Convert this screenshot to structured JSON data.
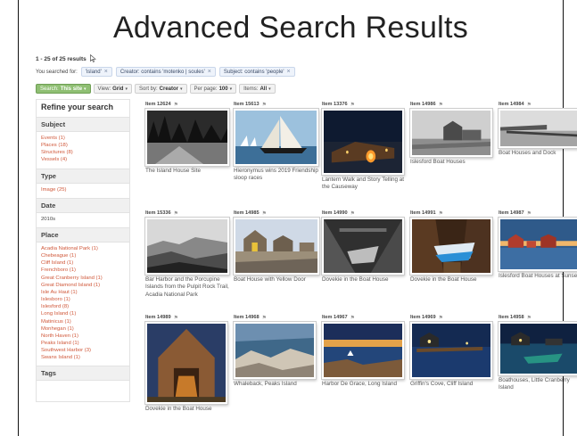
{
  "page_title": "Advanced Search Results",
  "results_count": "1 - 25 of 25 results",
  "searched_for_label": "You searched for:",
  "search_chips": [
    {
      "text": "'island'",
      "close": "×"
    },
    {
      "text": "Creator: contains 'motenko | soules'",
      "close": "×"
    },
    {
      "text": "Subject: contains 'people'",
      "close": "×"
    }
  ],
  "toolbar": {
    "search_prefix": "Search:",
    "search_value": "This site",
    "view_prefix": "View:",
    "view_value": "Grid",
    "sort_prefix": "Sort by:",
    "sort_value": "Creator",
    "per_page_prefix": "Per page:",
    "per_page_value": "100",
    "items_prefix": "Items:",
    "items_value": "All",
    "caret": "▾"
  },
  "sidebar": {
    "title": "Refine your search",
    "sections": [
      {
        "heading": "Subject",
        "items": [
          "Events (1)",
          "Places (18)",
          "Structures (8)",
          "Vessels (4)"
        ],
        "plain": false
      },
      {
        "heading": "Type",
        "items": [
          "Image (25)"
        ],
        "plain": false
      },
      {
        "heading": "Date",
        "items": [
          "2010s"
        ],
        "plain": true
      },
      {
        "heading": "Place",
        "items": [
          "Acadia National Park (1)",
          "Chebeague (1)",
          "Cliff Island (1)",
          "Frenchboro (1)",
          "Great Cranberry Island (1)",
          "Great Diamond Island (1)",
          "Isle Au Haut (1)",
          "Islesboro (1)",
          "Islesford (8)",
          "Long Island (1)",
          "Matinicus (1)",
          "Monhegan (1)",
          "North Haven (1)",
          "Peaks Island (1)",
          "Southwest Harbor (3)",
          "Swans Island (1)"
        ],
        "plain": false
      },
      {
        "heading": "Tags",
        "items": [],
        "plain": false
      }
    ]
  },
  "flag_glyph": "⚑",
  "grid_items": [
    {
      "label": "Item 12624",
      "caption": "The Island House Site",
      "scene": "bw-trees"
    },
    {
      "label": "Item 15613",
      "caption": "Hieronymus wins 2019 Friendship sloop races",
      "scene": "sailboat"
    },
    {
      "label": "Item 13376",
      "caption": "Lantern Walk and Story Telling at the Causeway",
      "scene": "night-fire"
    },
    {
      "label": "Item 14986",
      "caption": "Islesford Boat Houses",
      "scene": "bw-houses"
    },
    {
      "label": "Item 14984",
      "caption": "Boat Houses and Dock",
      "scene": "bw-dock"
    },
    {
      "label": "Item 15336",
      "caption": "Bar Harbor and the Porcupine Islands from the Pulpit Rock Trail, Acadia National Park",
      "scene": "bw-landscape"
    },
    {
      "label": "Item 14985",
      "caption": "Boat House with Yellow Door",
      "scene": "yellow-door"
    },
    {
      "label": "Item 14990",
      "caption": "Dovekie in the Boat House",
      "scene": "bw-boat"
    },
    {
      "label": "Item 14991",
      "caption": "Dovekie in the Boat House",
      "scene": "blue-boat"
    },
    {
      "label": "Item 14987",
      "caption": "Islesford Boat Houses at Sunset",
      "scene": "sunset-houses"
    },
    {
      "label": "Item 14989",
      "caption": "Dovekie in the Boat House",
      "scene": "barn"
    },
    {
      "label": "Item 14968",
      "caption": "Whaleback, Peaks Island",
      "scene": "rocks"
    },
    {
      "label": "Item 14967",
      "caption": "Harbor De Grace, Long Island",
      "scene": "harbor-sunset"
    },
    {
      "label": "Item 14969",
      "caption": "Griffin's Cove, Cliff Island",
      "scene": "cove-night"
    },
    {
      "label": "Item 14958",
      "caption": "Boathouses, Little Cranberry Island",
      "scene": "boathouses-night"
    }
  ]
}
